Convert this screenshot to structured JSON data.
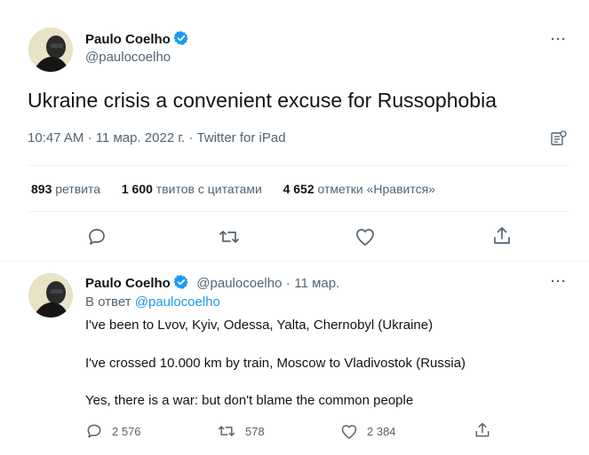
{
  "main_tweet": {
    "author_name": "Paulo Coelho",
    "author_handle": "@paulocoelho",
    "text": "Ukraine crisis a convenient excuse for Russophobia",
    "time": "10:47 AM",
    "sep1": "·",
    "date": "11 мар. 2022 г.",
    "sep2": "·",
    "source": "Twitter for iPad",
    "stats": {
      "retweets_count": "893",
      "retweets_label": "ретвита",
      "quotes_count": "1 600",
      "quotes_label": "твитов с цитатами",
      "likes_count": "4 652",
      "likes_label": "отметки «Нравится»"
    },
    "more_label": "···"
  },
  "reply_tweet": {
    "author_name": "Paulo Coelho",
    "author_handle": "@paulocoelho",
    "sep": "·",
    "date": "11 мар.",
    "reply_prefix": "В ответ",
    "reply_to": "@paulocoelho",
    "lines": [
      "I've been to Lvov, Kyiv, Odessa, Yalta, Chernobyl (Ukraine)",
      "I've crossed 10.000 km by train, Moscow to Vladivostok (Russia)",
      "Yes, there is a war: but don't blame the common people"
    ],
    "reply_count": "2 576",
    "retweet_count": "578",
    "like_count": "2 384",
    "more_label": "···"
  },
  "colors": {
    "text_primary": "#0f1419",
    "text_secondary": "#536471",
    "verified_blue": "#1d9bf0",
    "link_blue": "#1d9bf0",
    "divider": "#eff3f4"
  },
  "icons": {
    "verified": "verified-badge-icon",
    "reply": "reply-bubble-icon",
    "retweet": "retweet-icon",
    "like": "heart-icon",
    "share": "share-icon",
    "more": "more-dots-icon",
    "analytics": "analytics-icon"
  }
}
